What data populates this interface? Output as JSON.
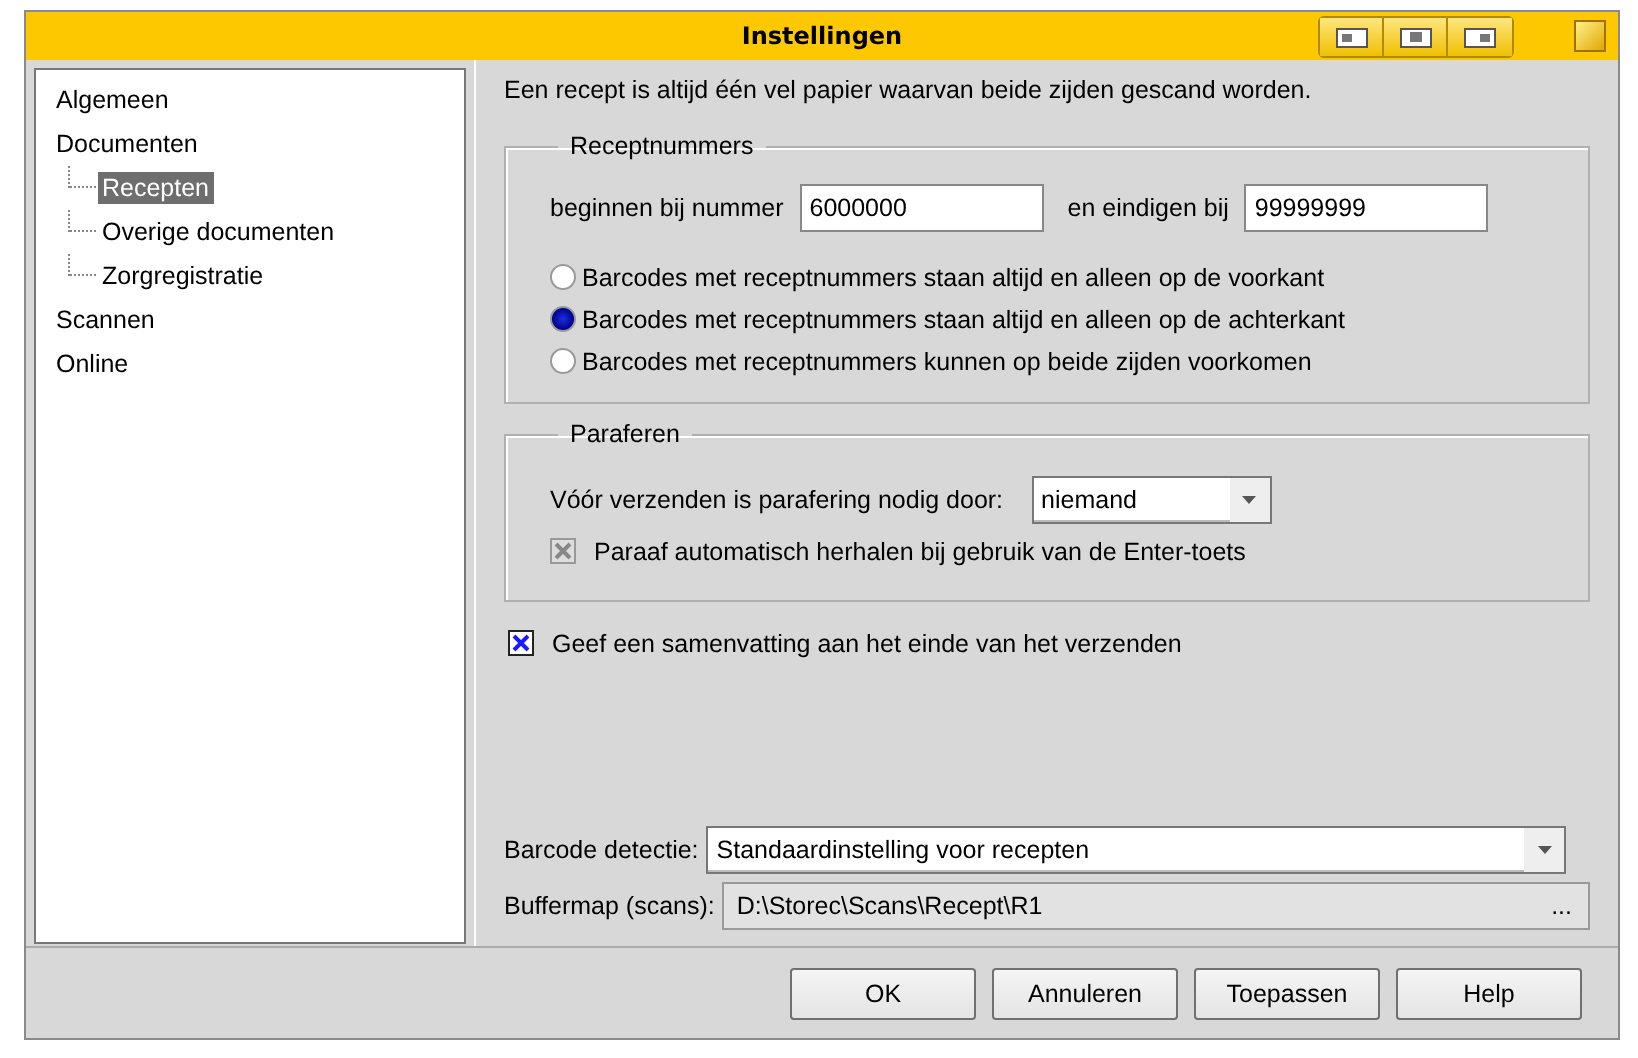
{
  "window": {
    "title": "Instellingen"
  },
  "tree": [
    {
      "label": "Algemeen",
      "selected": false
    },
    {
      "label": "Documenten",
      "selected": false,
      "children": [
        {
          "label": "Recepten",
          "selected": true
        },
        {
          "label": "Overige documenten",
          "selected": false
        },
        {
          "label": "Zorgregistratie",
          "selected": false
        }
      ]
    },
    {
      "label": "Scannen",
      "selected": false
    },
    {
      "label": "Online",
      "selected": false
    }
  ],
  "intro": "Een recept is altijd één vel papier waarvan beide zijden gescand worden.",
  "receptnummers": {
    "legend": "Receptnummers",
    "start_label": "beginnen bij nummer",
    "start_value": "6000000",
    "end_label": "en eindigen bij",
    "end_value": "99999999",
    "options": [
      {
        "label": "Barcodes met receptnummers staan altijd en alleen op de voorkant",
        "selected": false
      },
      {
        "label": "Barcodes met receptnummers staan altijd en alleen op de achterkant",
        "selected": true
      },
      {
        "label": "Barcodes met receptnummers kunnen op beide zijden voorkomen",
        "selected": false
      }
    ]
  },
  "paraferen": {
    "legend": "Paraferen",
    "label": "Vóór verzenden is parafering nodig door:",
    "value": "niemand",
    "repeat": {
      "label": "Paraaf automatisch herhalen bij gebruik van de Enter-toets",
      "checked": true,
      "disabled": true
    }
  },
  "summary": {
    "label": "Geef een samenvatting aan het einde van het verzenden",
    "checked": true
  },
  "barcode": {
    "label": "Barcode detectie:",
    "value": "Standaardinstelling voor recepten"
  },
  "buffer": {
    "label": "Buffermap (scans):",
    "value": "D:\\Storec\\Scans\\Recept\\R1",
    "browse": "..."
  },
  "buttons": [
    "OK",
    "Annuleren",
    "Toepassen",
    "Help"
  ]
}
